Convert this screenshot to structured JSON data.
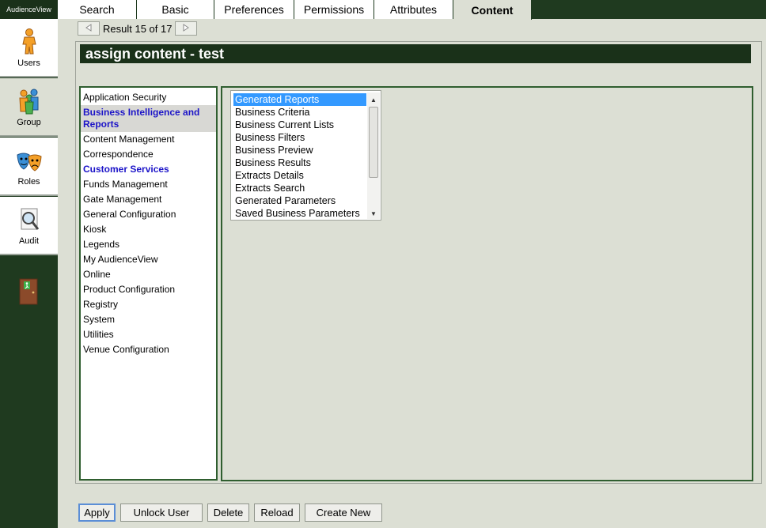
{
  "app": {
    "brand": "AudienceView"
  },
  "sidebar": {
    "items": [
      {
        "label": "Users",
        "icon": "user-icon"
      },
      {
        "label": "Group",
        "icon": "group-icon"
      },
      {
        "label": "Roles",
        "icon": "masks-icon"
      },
      {
        "label": "Audit",
        "icon": "magnifier-icon"
      }
    ],
    "exit_icon": "exit-door-icon"
  },
  "tabs": [
    {
      "label": "Search"
    },
    {
      "label": "Basic"
    },
    {
      "label": "Preferences"
    },
    {
      "label": "Permissions"
    },
    {
      "label": "Attributes"
    },
    {
      "label": "Content",
      "active": true
    }
  ],
  "result_nav": {
    "text": "Result 15 of 17"
  },
  "page": {
    "title": "assign content - test"
  },
  "categories": [
    {
      "label": "Application Security"
    },
    {
      "label": "Business Intelligence and Reports",
      "selected": true
    },
    {
      "label": "Content Management"
    },
    {
      "label": "Correspondence"
    },
    {
      "label": "Customer Services",
      "style": "bold-blue"
    },
    {
      "label": "Funds Management"
    },
    {
      "label": "Gate Management"
    },
    {
      "label": "General Configuration"
    },
    {
      "label": "Kiosk"
    },
    {
      "label": "Legends"
    },
    {
      "label": "My AudienceView"
    },
    {
      "label": "Online"
    },
    {
      "label": "Product Configuration"
    },
    {
      "label": "Registry"
    },
    {
      "label": "System"
    },
    {
      "label": "Utilities"
    },
    {
      "label": "Venue Configuration"
    }
  ],
  "reports": [
    {
      "label": "Generated Reports",
      "selected": true
    },
    {
      "label": "Business Criteria"
    },
    {
      "label": "Business Current Lists"
    },
    {
      "label": "Business Filters"
    },
    {
      "label": "Business Preview"
    },
    {
      "label": "Business Results"
    },
    {
      "label": "Extracts Details"
    },
    {
      "label": "Extracts Search"
    },
    {
      "label": "Generated Parameters"
    },
    {
      "label": "Saved Business Parameters"
    }
  ],
  "buttons": {
    "apply": "Apply",
    "unlock_user": "Unlock User",
    "delete": "Delete",
    "reload": "Reload",
    "create_new": "Create New"
  },
  "colors": {
    "dark_green": "#1f3a1f",
    "panel_bg": "#dcdfd4",
    "selection_blue": "#3399ff",
    "link_blue": "#1c14c8"
  }
}
